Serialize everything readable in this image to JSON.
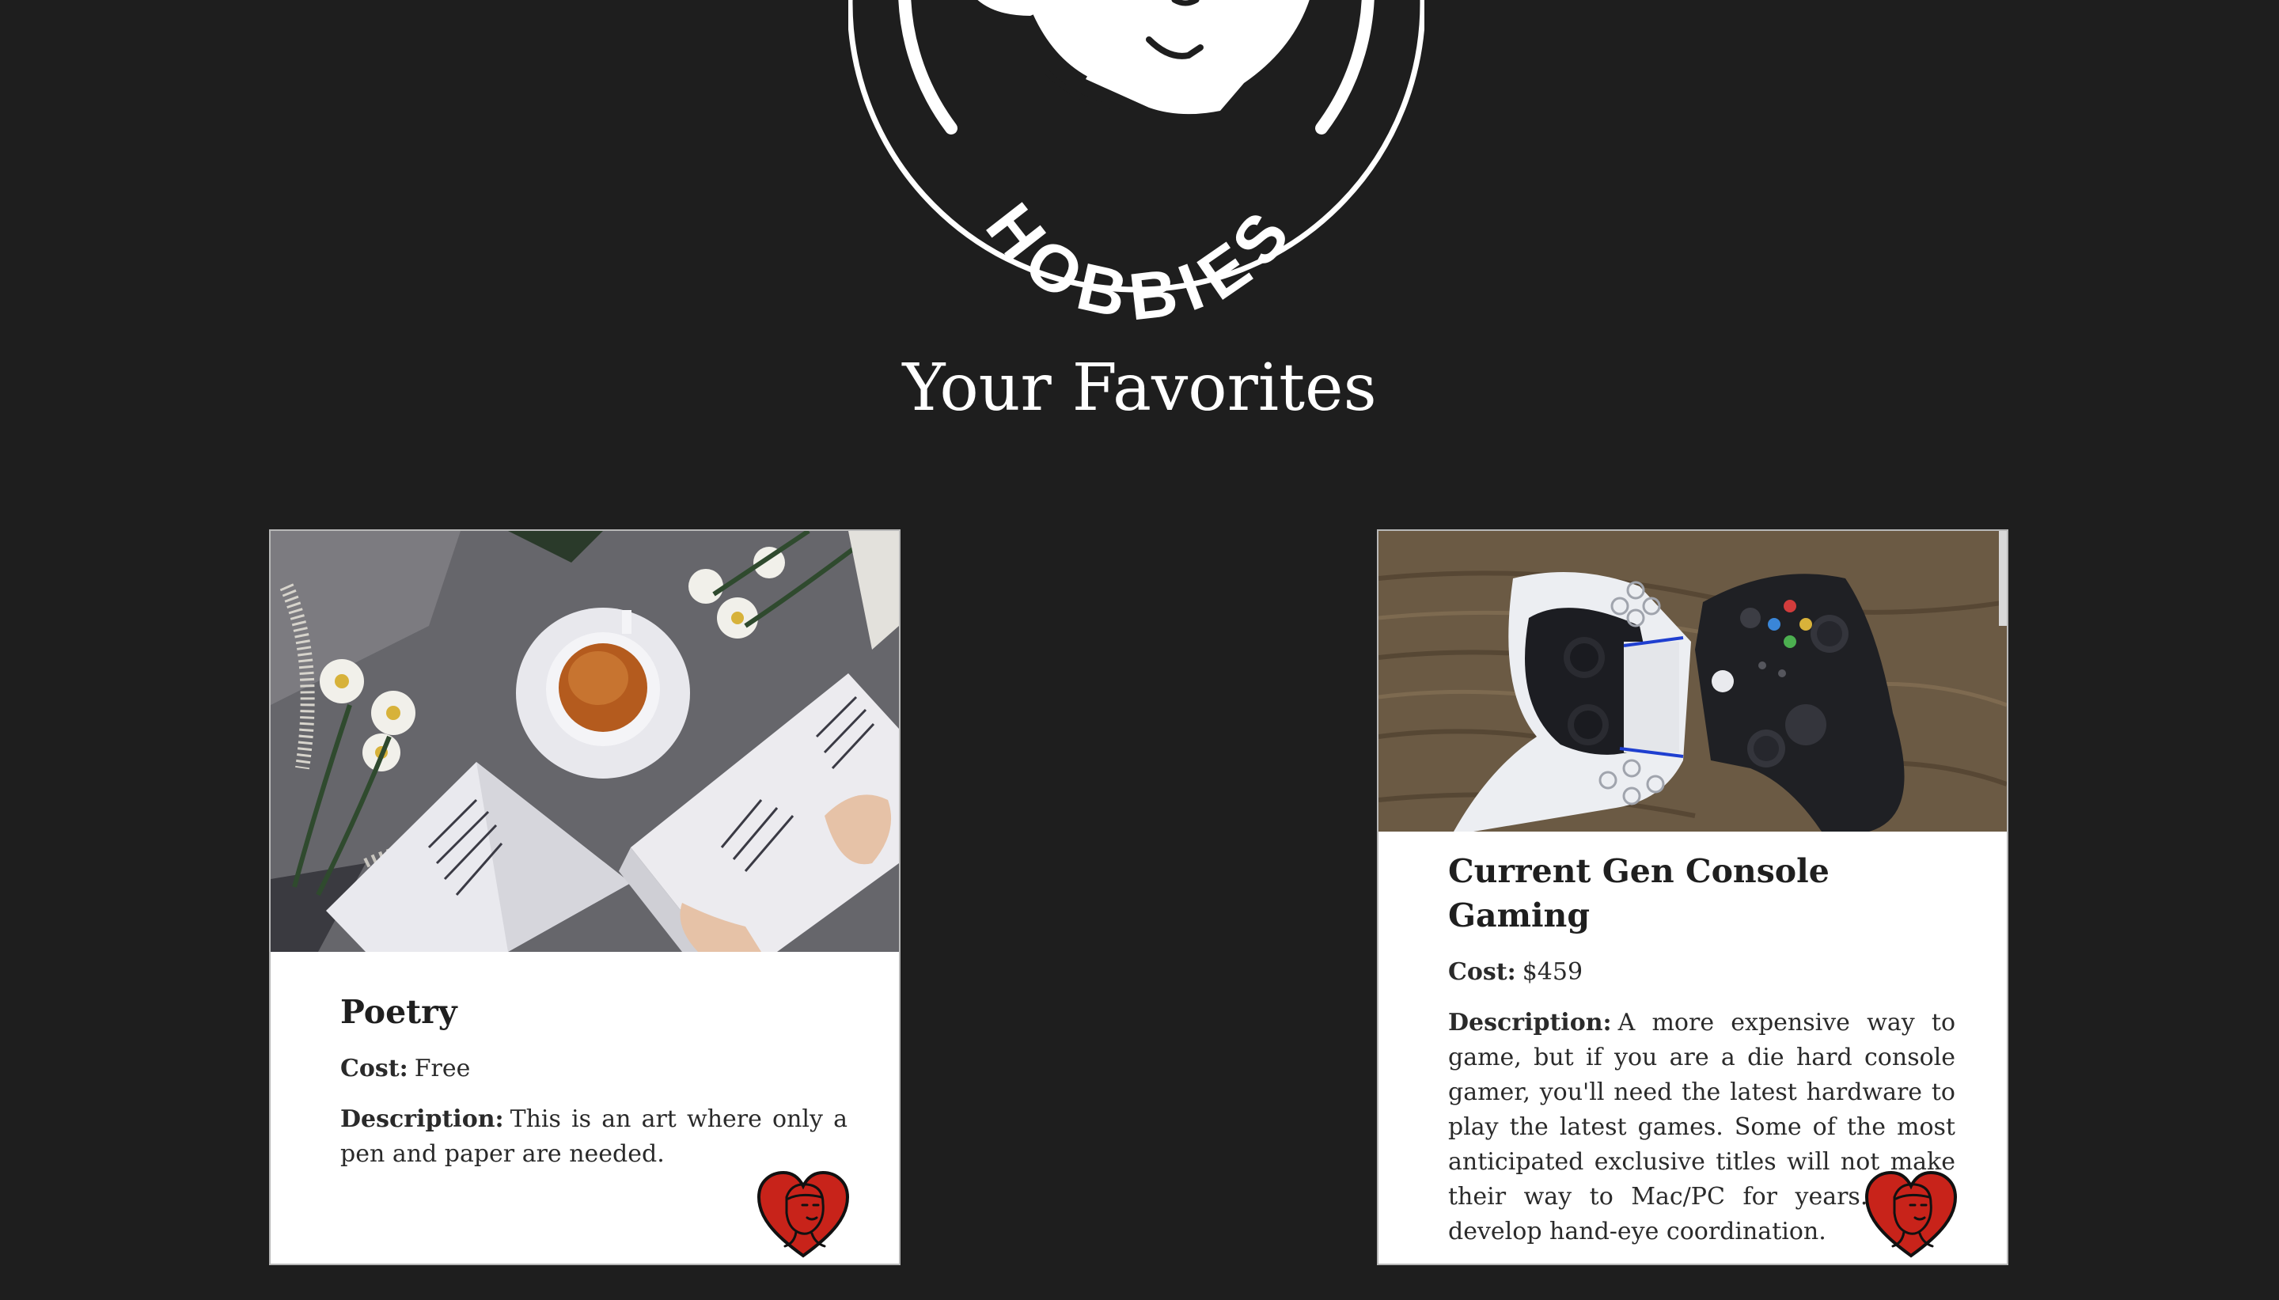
{
  "header": {
    "logo_text": "HOBBIES",
    "title": "Your Favorites"
  },
  "cards": [
    {
      "title": "Poetry",
      "cost_label": "Cost:",
      "cost": "Free",
      "description_label": "Description:",
      "description": "This is an art where only a pen and paper are needed."
    },
    {
      "title": "Current Gen Console Gaming",
      "cost_label": "Cost:",
      "cost": "$459",
      "description_label": "Description:",
      "description": "A more expensive way to game, but if you are a die hard console gamer, you'll need the latest hardware to play the latest games. Some of the most anticipated exclusive titles will not make their way to Mac/PC for years. Helps develop hand-eye coordination."
    }
  ],
  "colors": {
    "background": "#1e1e1e",
    "heart": "#c8231a",
    "card": "#ffffff"
  },
  "icons": [
    "hobbies-logo-icon",
    "favorite-heart-icon"
  ]
}
